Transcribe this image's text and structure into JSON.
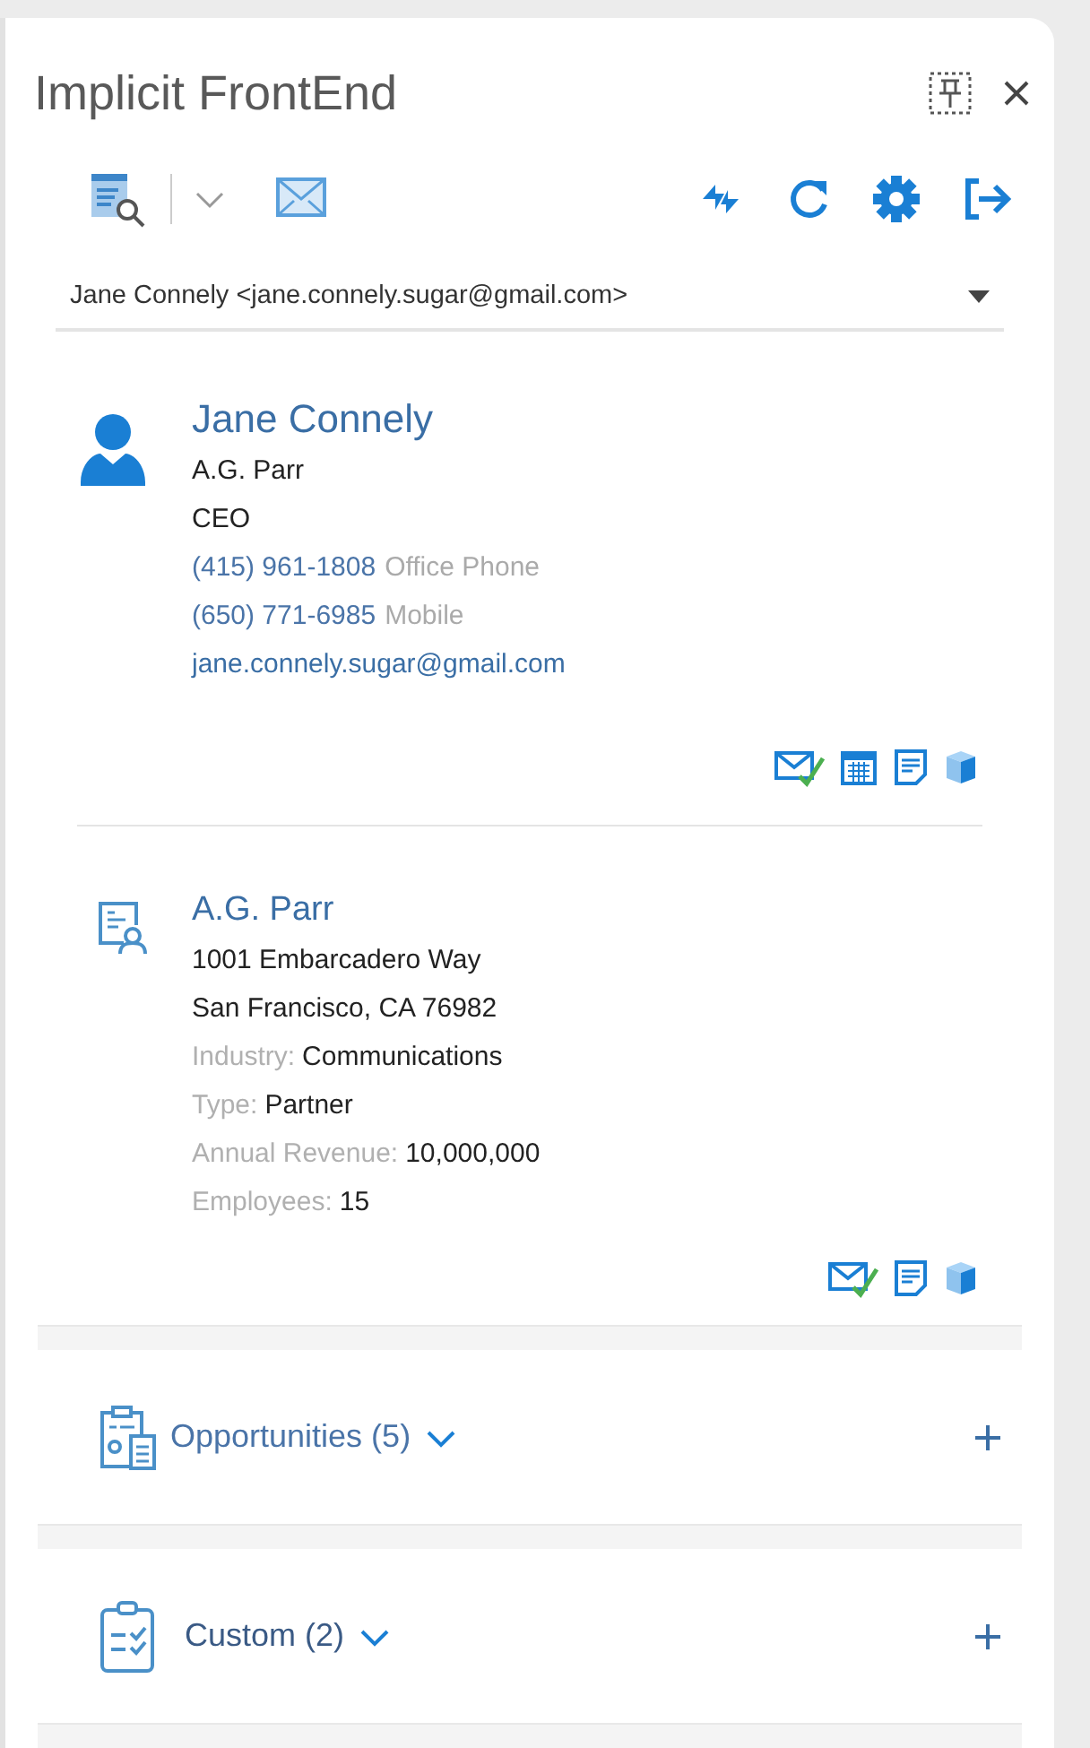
{
  "title": "Implicit FrontEnd",
  "contact_selector": {
    "value": "Jane Connely <jane.connely.sugar@gmail.com>"
  },
  "contact": {
    "name": "Jane Connely",
    "company": "A.G. Parr",
    "job_title": "CEO",
    "phones": [
      {
        "number": "(415) 961-1808",
        "label": "Office Phone"
      },
      {
        "number": "(650) 771-6985",
        "label": "Mobile"
      }
    ],
    "email": "jane.connely.sugar@gmail.com",
    "actions": [
      {
        "kind": "email"
      },
      {
        "kind": "calendar"
      },
      {
        "kind": "note"
      },
      {
        "kind": "cube"
      }
    ]
  },
  "account": {
    "name": "A.G. Parr",
    "address": [
      "1001 Embarcadero Way",
      "San Francisco, CA 76982"
    ],
    "fields": [
      {
        "label": "Industry:",
        "value": "Communications"
      },
      {
        "label": "Type:",
        "value": "Partner"
      },
      {
        "label": "Annual Revenue:",
        "value": "10,000,000"
      },
      {
        "label": "Employees:",
        "value": "15"
      }
    ],
    "actions": [
      {
        "kind": "email"
      },
      {
        "kind": "note"
      },
      {
        "kind": "cube"
      }
    ]
  },
  "sections": [
    {
      "kind": "opportunities",
      "label": "Opportunities (5)"
    },
    {
      "kind": "custom",
      "label": "Custom (2)"
    }
  ]
}
